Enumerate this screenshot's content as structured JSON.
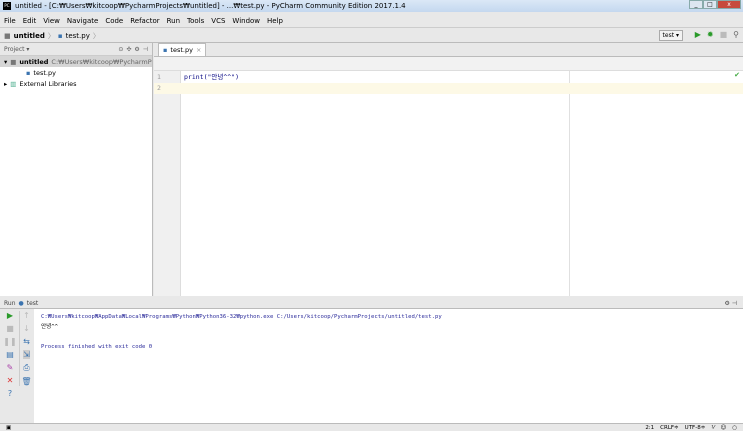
{
  "title": "untitled - [C:₩Users₩kitcoop₩PycharmProjects₩untitled] - ...₩test.py - PyCharm Community Edition 2017.1.4",
  "menu": [
    "File",
    "Edit",
    "View",
    "Navigate",
    "Code",
    "Refactor",
    "Run",
    "Tools",
    "VCS",
    "Window",
    "Help"
  ],
  "breadcrumb": {
    "project": "untitled",
    "file": "test.py"
  },
  "run_config": "test ▾",
  "project_panel": {
    "label": "Project ▾",
    "root": "untitled",
    "root_path": "C:₩Users₩kitcoop₩PycharmProjects₩untitled",
    "file": "test.py",
    "libs": "External Libraries"
  },
  "tab": {
    "label": "test.py",
    "close": "×"
  },
  "editor": {
    "lines": [
      {
        "n": "1",
        "code": "print(\"안녕^^\")"
      },
      {
        "n": "2",
        "code": ""
      }
    ]
  },
  "run": {
    "label": "Run",
    "config": "test",
    "cmd": "C:₩Users₩kitcoop₩AppData₩Local₩Programs₩Python₩Python36-32₩python.exe C:/Users/kitcoop/PycharmProjects/untitled/test.py",
    "output": "안녕^^",
    "finish": "Process finished with exit code 0"
  },
  "status": {
    "pos": "2:1",
    "eol": "CRLF≑",
    "enc": "UTF-8≑"
  }
}
